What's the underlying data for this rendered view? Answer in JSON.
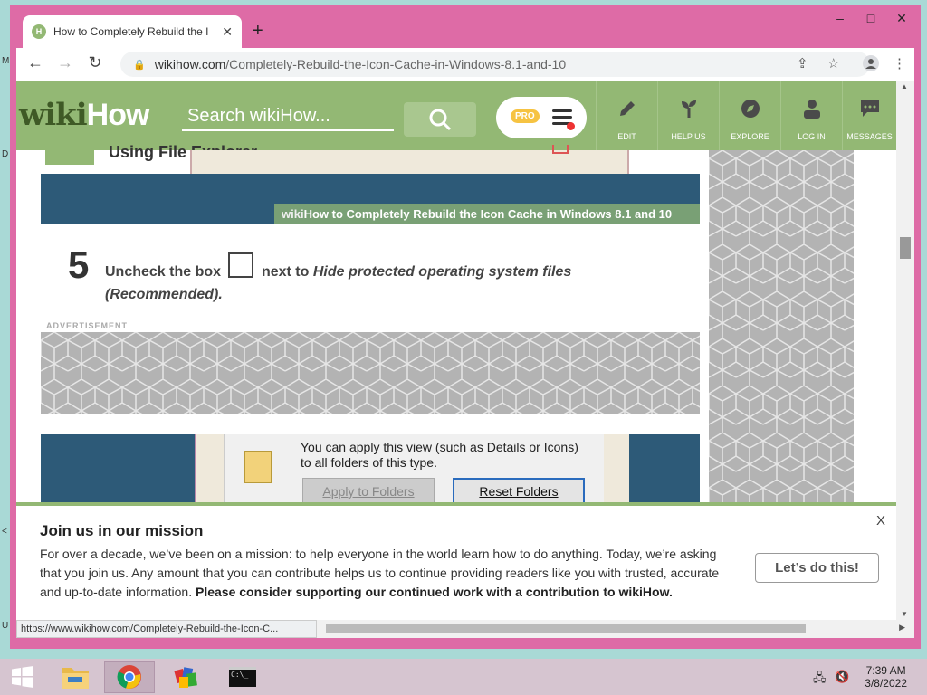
{
  "desktop": {
    "letters": [
      "M",
      "D",
      "<",
      "U"
    ]
  },
  "window": {
    "controls": [
      "–",
      "□",
      "✕"
    ]
  },
  "tab": {
    "title": "How to Completely Rebuild the I",
    "favicon_text": "H"
  },
  "address_bar": {
    "domain": "wikihow.com",
    "path": "/Completely-Rebuild-the-Icon-Cache-in-Windows-8.1-and-10"
  },
  "wikihow": {
    "logo_wiki": "wiki",
    "logo_how": "How",
    "search_placeholder": "Search wikiHow...",
    "pro_badge": "PRO",
    "nav": [
      {
        "label": "EDIT",
        "icon": "pencil-icon"
      },
      {
        "label": "HELP US",
        "icon": "sprout-icon"
      },
      {
        "label": "EXPLORE",
        "icon": "compass-icon"
      },
      {
        "label": "LOG IN",
        "icon": "user-icon"
      },
      {
        "label": "MESSAGES",
        "icon": "chat-bubble-icon"
      }
    ],
    "brand_color": "#93b874"
  },
  "article": {
    "section_title": "Using File Explorer",
    "image_caption_wiki": "wiki",
    "image_caption_how": "How",
    "image_caption_rest": " to Completely Rebuild the Icon Cache in Windows 8.1 and 10",
    "step_number": "5",
    "step_text_before": "Uncheck the box",
    "step_text_after": "next to",
    "step_text_italic": "Hide protected operating system files (Recommended).",
    "ad_label": "ADVERTISEMENT",
    "folder_dialog": {
      "description": "You can apply this view (such as Details or Icons) to all folders of this type.",
      "apply_button": "Apply to Folders",
      "reset_button": "Reset Folders"
    }
  },
  "banner": {
    "title": "Join us in our mission",
    "body": "For over a decade, we’ve been on a mission: to help everyone in the world learn how to do anything. Today, we’re asking that you join us. Any amount that you can contribute helps us to continue providing readers like you with trusted, accurate and up-to-date information.",
    "body_bold": "Please consider supporting our continued work with a contribution to wikiHow.",
    "cta": "Let’s do this!",
    "close": "X"
  },
  "status_bar": {
    "url": "https://www.wikihow.com/Completely-Rebuild-the-Icon-C..."
  },
  "taskbar": {
    "time": "7:39 AM",
    "date": "3/8/2022",
    "cmd_text": "C:\\_"
  }
}
